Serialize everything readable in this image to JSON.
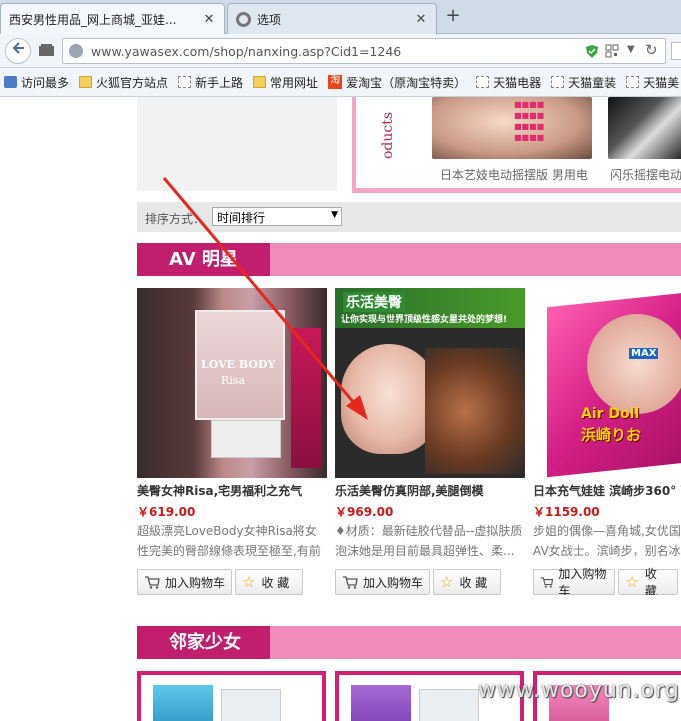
{
  "tabs": [
    {
      "title": "西安男性用品_网上商城_亚娃...",
      "close": "✕"
    },
    {
      "title": "选项",
      "close": "✕"
    }
  ],
  "new_tab": "+",
  "nav": {
    "url": "www.yawasex.com/shop/nanxing.asp?Cid1=1246"
  },
  "bookmarks": [
    "访问最多",
    "火狐官方站点",
    "新手上路",
    "常用网址",
    "爱淘宝（原淘宝特卖）",
    "天猫电器",
    "天猫童装",
    "天猫美"
  ],
  "banner": {
    "text": "oducts",
    "captions": [
      "日本艺妓电动摇摆版 男用电",
      "闪乐摇摆电动"
    ]
  },
  "sort": {
    "label": "排序方式：",
    "value": "时间排行"
  },
  "sections": [
    {
      "title": "AV 明星"
    },
    {
      "title": "邻家少女"
    }
  ],
  "products": [
    {
      "title": "美臀女神Risa,宅男福利之充气",
      "price": "￥619.00",
      "desc": "超級漂亮LoveBody女神Risa將女性完美的臀部線條表現至極至,有前有..."
    },
    {
      "title": "乐活美臀仿真阴部,美腿倒模",
      "price": "￥969.00",
      "desc": "♦材质：最新硅胶代替品--虚拟肤质泡沫她是用目前最具超弹性、柔..."
    },
    {
      "title": "日本充气娃娃 滨崎步360° 西",
      "price": "￥1159.00",
      "desc": "步姐的偶像—喜角城,女优国AV女战士。滨崎步，别名冰"
    }
  ],
  "buttons": {
    "cart": "加入购物车",
    "fav": "收 藏"
  },
  "image_text": {
    "love_body": "LOVE BODY",
    "risa": "Risa",
    "lehuo": "乐活美臀",
    "lehuo_sub": "让你实现与世界顶级性感女星共处的梦想!",
    "air_doll": "Air Doll",
    "hamasaki": "浜崎りお",
    "max": "MAX"
  },
  "watermark": "www.wooyun.org",
  "colors": {
    "accent_pink": "#c21e6e",
    "section_bar": "#f08cbb",
    "price": "#d01616"
  }
}
